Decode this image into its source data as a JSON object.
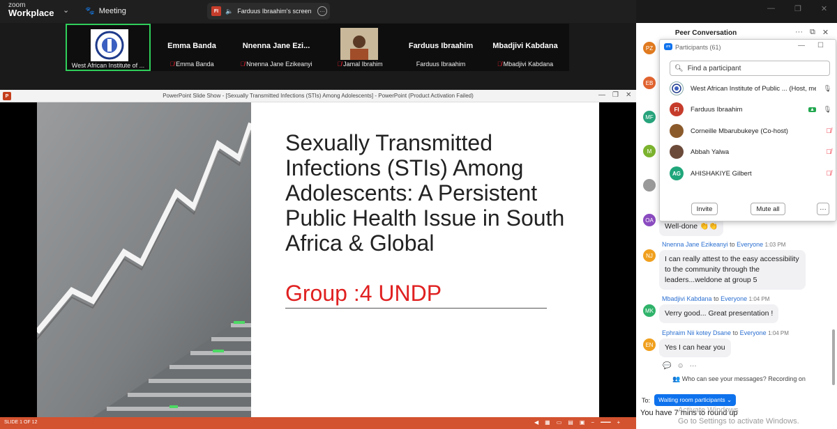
{
  "topbar": {
    "logo_small": "zoom",
    "logo_big": "Workplace",
    "meeting_label": "Meeting",
    "share_badge": "FI",
    "share_label": "Farduus Ibraahim's screen"
  },
  "gallery": {
    "tiles": [
      {
        "name_big": "",
        "name_sub": "West African Institute of ..."
      },
      {
        "name_big": "Emma Banda",
        "name_sub": "Emma Banda"
      },
      {
        "name_big": "Nnenna Jane Ezi...",
        "name_sub": "Nnenna Jane Ezikeanyi"
      },
      {
        "name_big": "",
        "name_sub": "Jamal Ibrahim"
      },
      {
        "name_big": "Farduus Ibraahim",
        "name_sub": "Farduus Ibraahim"
      },
      {
        "name_big": "Mbadjivi Kabdana",
        "name_sub": "Mbadjivi Kabdana"
      }
    ]
  },
  "ppt": {
    "window_title": "PowerPoint Slide Show - [Sexually Transmitted Infections (STIs) Among Adolescents] - PowerPoint (Product Activation Failed)",
    "icon": "P",
    "slide_title": "Sexually Transmitted Infections (STIs) Among Adolescents: A Persistent Public Health Issue in South Africa & Global",
    "slide_subtitle": "Group :4 UNDP",
    "slide_counter": "SLIDE 1 OF 12"
  },
  "chat": {
    "title": "Peer Conversation",
    "avatars": [
      {
        "initials": "PZ",
        "color": "#e07a1f"
      },
      {
        "initials": "EB",
        "color": "#e0632f"
      },
      {
        "initials": "MF",
        "color": "#27a37b"
      },
      {
        "initials": "M",
        "color": "#7bb32e"
      },
      {
        "initials": "",
        "color": "#999999"
      },
      {
        "initials": "OA",
        "color": "#8a4bbf"
      },
      {
        "initials": "NJ",
        "color": "#f0a01e"
      },
      {
        "initials": "MK",
        "color": "#2fb36a"
      },
      {
        "initials": "EN",
        "color": "#f0a01e"
      }
    ],
    "messages": [
      {
        "sender": "",
        "to": "",
        "recipient": "",
        "time": "",
        "text": "Well-done 👏👏"
      },
      {
        "sender": "Nnenna Jane Ezikeanyi",
        "to": "to",
        "recipient": "Everyone",
        "time": "1:03 PM",
        "text": "I can really attest to the easy accessibility to the community through the leaders...weldone at group 5"
      },
      {
        "sender": "Mbadjivi Kabdana",
        "to": "to",
        "recipient": "Everyone",
        "time": "1:04 PM",
        "text": "Verry good... Great presentation !"
      },
      {
        "sender": "Ephraim Nii kotey Dsane",
        "to": "to",
        "recipient": "Everyone",
        "time": "1:04 PM",
        "text": "Yes I can hear you"
      }
    ],
    "who_can_see": "Who can see your messages? Recording on",
    "to_label": "To:",
    "to_value": "Waiting room participants",
    "input_text": "You have 7 mins to round up",
    "activate_line1": "Activate Windows",
    "activate_line2": "Go to Settings to activate Windows."
  },
  "participants": {
    "title": "Participants (61)",
    "search_placeholder": "Find a participant",
    "list": [
      {
        "name": "West African Institute of Public ... (Host, me)",
        "initials": "",
        "color": "#ffffff"
      },
      {
        "name": "Farduus Ibraahim",
        "initials": "FI",
        "color": "#c63c2b"
      },
      {
        "name": "Corneille Mbarubukeye (Co-host)",
        "initials": "",
        "color": "#8b5a2b"
      },
      {
        "name": "Abbah Yalwa",
        "initials": "",
        "color": "#6b4a3a"
      },
      {
        "name": "AHISHAKIYE Gilbert",
        "initials": "AG",
        "color": "#1fa67a"
      }
    ],
    "invite_label": "Invite",
    "mute_all_label": "Mute all",
    "more_label": "···"
  }
}
